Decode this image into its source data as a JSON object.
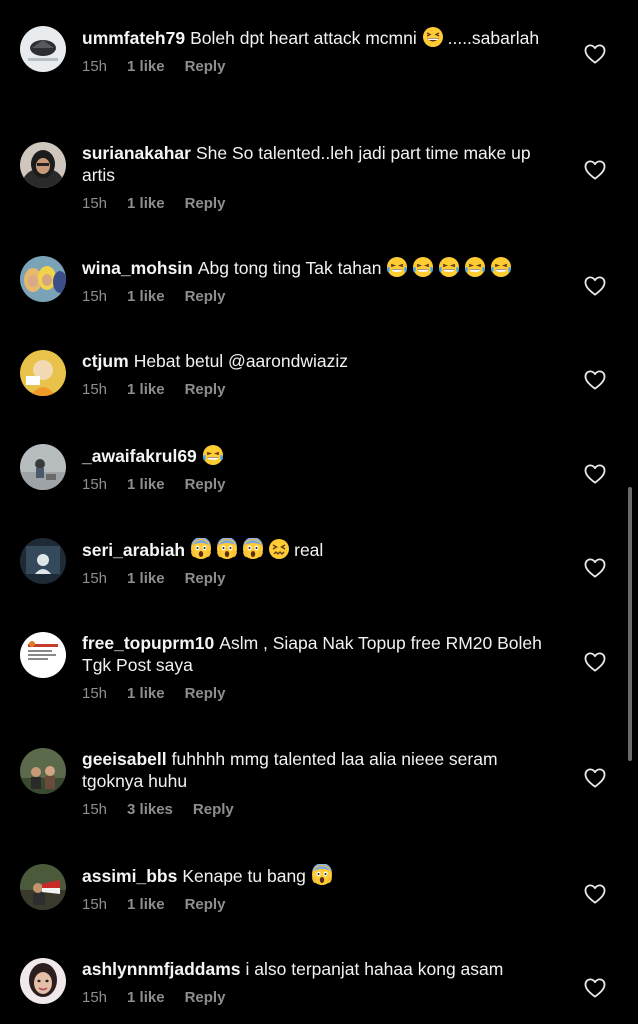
{
  "colors": {
    "background": "#000000",
    "text": "#f2f2f2",
    "meta": "#8e8e8e"
  },
  "comments": [
    {
      "username": "ummfateh79",
      "text_before": "Boleh  dpt  heart  attack  mcmni",
      "emojis": [
        "grinning-squint-emoji"
      ],
      "text_after": ".....sabarlah",
      "time": "15h",
      "likes": "1 like",
      "reply": "Reply",
      "like_icon": "heart-outline-icon"
    },
    {
      "username": "surianakahar",
      "text_before": "She So talented..leh jadi part time make up artis",
      "emojis": [],
      "text_after": "",
      "time": "15h",
      "likes": "1 like",
      "reply": "Reply",
      "like_icon": "heart-outline-icon"
    },
    {
      "username": "wina_mohsin",
      "text_before": "Abg tong ting Tak tahan",
      "emojis": [
        "tears-of-joy-emoji",
        "tears-of-joy-emoji",
        "tears-of-joy-emoji",
        "tears-of-joy-emoji",
        "tears-of-joy-emoji"
      ],
      "text_after": "",
      "time": "15h",
      "likes": "1 like",
      "reply": "Reply",
      "like_icon": "heart-outline-icon"
    },
    {
      "username": "ctjum",
      "text_before": "Hebat betul @aarondwiaziz",
      "emojis": [],
      "text_after": "",
      "time": "15h",
      "likes": "1 like",
      "reply": "Reply",
      "like_icon": "heart-outline-icon"
    },
    {
      "username": "_awaifakrul69",
      "text_before": "",
      "emojis": [
        "tears-of-joy-emoji"
      ],
      "text_after": "",
      "time": "15h",
      "likes": "1 like",
      "reply": "Reply",
      "like_icon": "heart-outline-icon"
    },
    {
      "username": "seri_arabiah",
      "text_before": "",
      "emojis": [
        "screaming-face-emoji",
        "screaming-face-emoji",
        "screaming-face-emoji",
        "confounded-face-emoji"
      ],
      "text_after": "real",
      "time": "15h",
      "likes": "1 like",
      "reply": "Reply",
      "like_icon": "heart-outline-icon"
    },
    {
      "username": "free_topuprm10",
      "text_before": "Aslm , Siapa Nak Topup free RM20 Boleh Tgk Post saya",
      "emojis": [],
      "text_after": "",
      "time": "15h",
      "likes": "1 like",
      "reply": "Reply",
      "like_icon": "heart-outline-icon"
    },
    {
      "username": "geeisabell",
      "text_before": "fuhhhh mmg talented laa alia nieee seram tgoknya huhu",
      "emojis": [],
      "text_after": "",
      "time": "15h",
      "likes": "3 likes",
      "reply": "Reply",
      "like_icon": "heart-outline-icon"
    },
    {
      "username": "assimi_bbs",
      "text_before": "Kenape tu bang",
      "emojis": [
        "screaming-face-emoji"
      ],
      "text_after": "",
      "time": "15h",
      "likes": "1 like",
      "reply": "Reply",
      "like_icon": "heart-outline-icon"
    },
    {
      "username": "ashlynnmfjaddams",
      "text_before": "i also terpanjat hahaa kong asam",
      "emojis": [],
      "text_after": "",
      "time": "15h",
      "likes": "1 like",
      "reply": "Reply",
      "like_icon": "heart-outline-icon"
    }
  ]
}
